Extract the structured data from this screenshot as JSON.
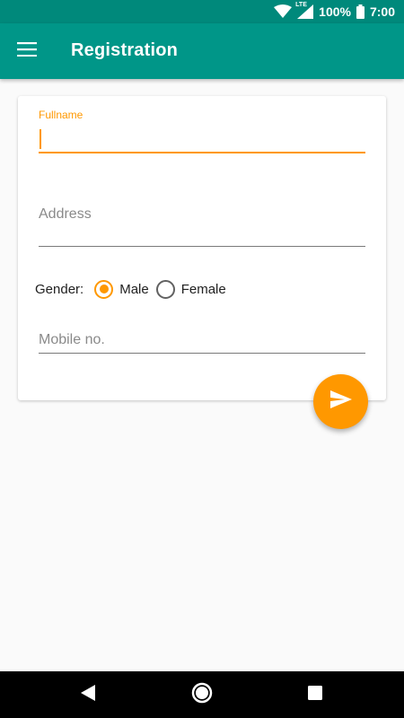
{
  "status_bar": {
    "network": "LTE",
    "battery": "100%",
    "time": "7:00"
  },
  "app_bar": {
    "title": "Registration",
    "menu_icon": "hamburger-menu-icon"
  },
  "form": {
    "fullname": {
      "label": "Fullname",
      "value": ""
    },
    "address": {
      "placeholder": "Address",
      "value": ""
    },
    "gender": {
      "label": "Gender:",
      "options": [
        "Male",
        "Female"
      ],
      "selected": "Male"
    },
    "mobile": {
      "placeholder": "Mobile no.",
      "value": ""
    }
  },
  "fab": {
    "icon": "send-icon"
  },
  "nav_bar": {
    "icons": [
      "back-icon",
      "home-icon",
      "recents-icon"
    ]
  },
  "colors": {
    "primary": "#009688",
    "primary_dark": "#00897b",
    "accent": "#ff9800"
  }
}
